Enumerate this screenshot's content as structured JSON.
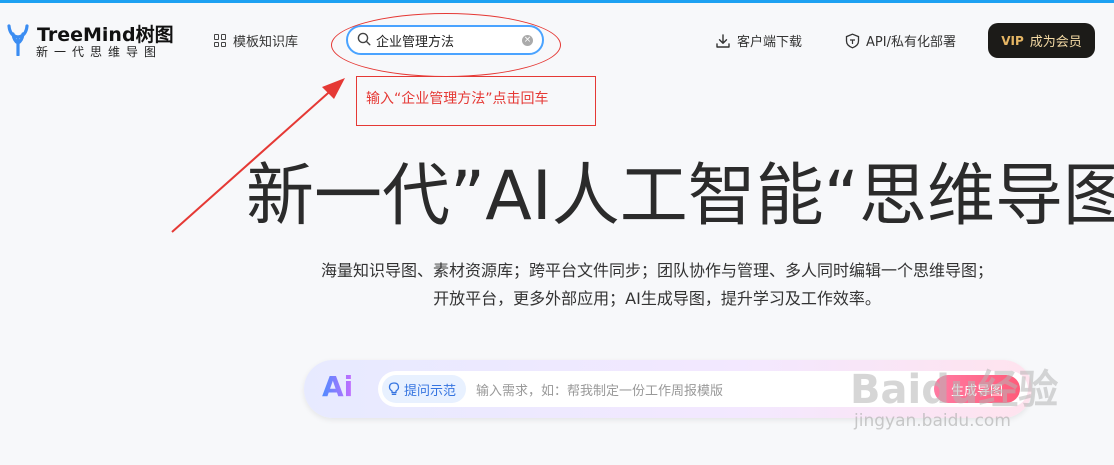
{
  "logo": {
    "brand": "TreeMind",
    "brand_cn": "树图",
    "tagline": "新一代思维导图"
  },
  "nav": {
    "templates": "模板知识库",
    "download": "客户端下载",
    "api": "API/私有化部署",
    "vip_tag": "VIP",
    "vip_label": "成为会员"
  },
  "search": {
    "value": "企业管理方法"
  },
  "annotation": {
    "text": "输入“企业管理方法”点击回车"
  },
  "hero": {
    "title": "新一代”AI人工智能“思维导图",
    "desc_line1": "海量知识导图、素材资源库；跨平台文件同步；团队协作与管理、多人同时编辑一个思维导图；",
    "desc_line2": "开放平台，更多外部应用；AI生成导图，提升学习及工作效率。"
  },
  "ai_bar": {
    "logo": "Ai",
    "prompt_chip": "提问示范",
    "placeholder": "输入需求，如：帮我制定一份工作周报模版",
    "button": "生成导图"
  },
  "watermark": {
    "main": "Baidu经验",
    "sub": "jingyan.baidu.com"
  },
  "colors": {
    "accent_blue": "#4aa3ff",
    "annotation_red": "#e53935",
    "vip_bg": "#1c1b18",
    "vip_text": "#f3d9a4"
  }
}
